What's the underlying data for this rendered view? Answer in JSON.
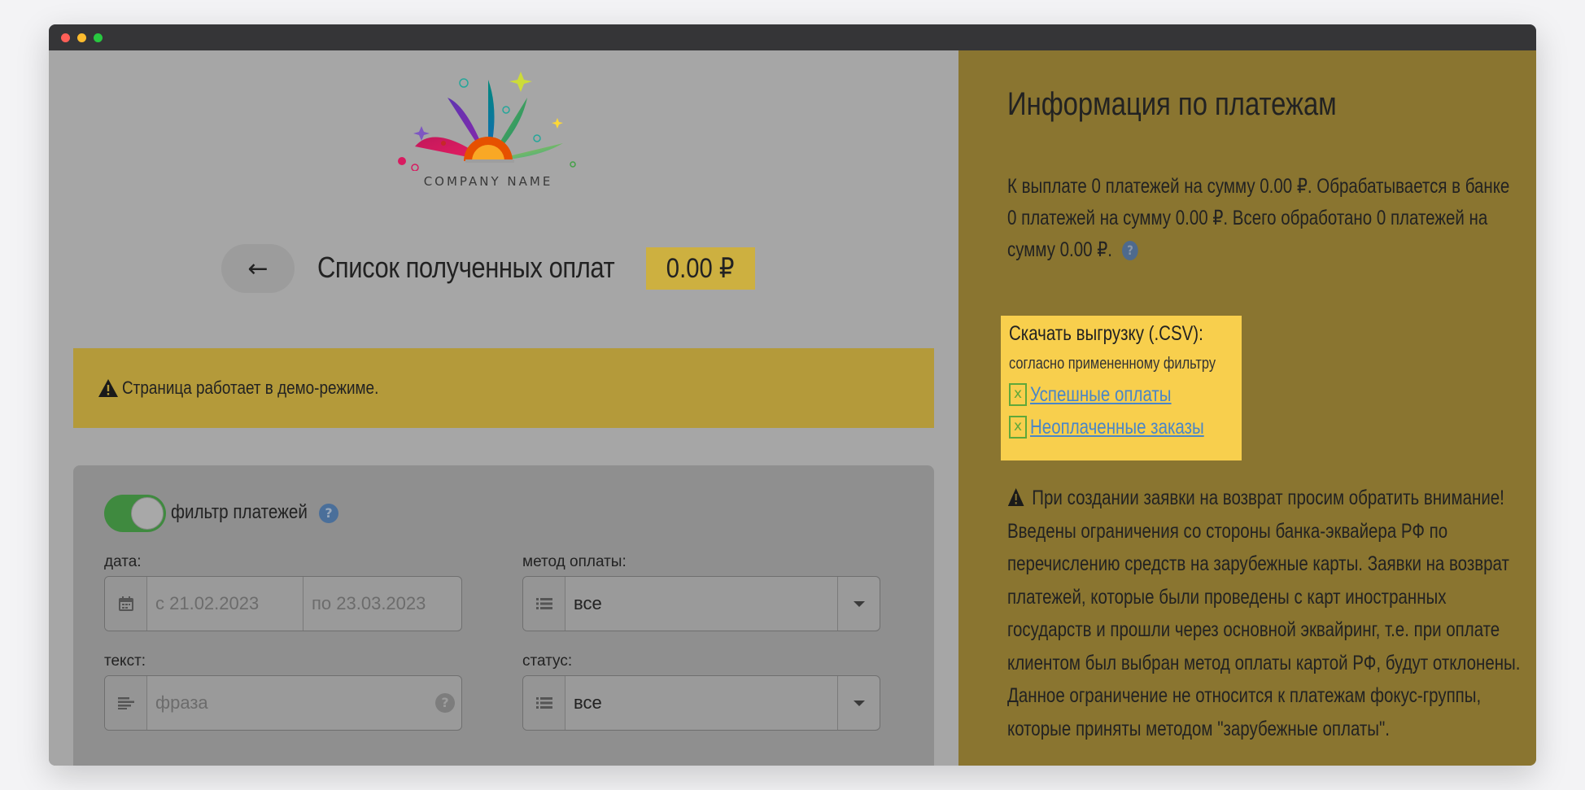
{
  "window": {
    "controls": [
      "close",
      "minimize",
      "maximize"
    ]
  },
  "logo": {
    "company_name": "COMPANY NAME"
  },
  "header": {
    "back_label": "←",
    "title": "Список полученных оплат",
    "total": "0.00 ₽"
  },
  "demo_alert": {
    "icon": "warning-icon",
    "text": "Страница работает в демо-режиме."
  },
  "filter": {
    "toggle_label": "фильтр платежей",
    "toggle_on": true,
    "date": {
      "label": "дата:",
      "from_placeholder": "с 21.02.2023",
      "to_placeholder": "по 23.03.2023"
    },
    "payment_method": {
      "label": "метод оплаты:",
      "value": "все"
    },
    "text": {
      "label": "текст:",
      "placeholder": "фраза"
    },
    "status": {
      "label": "статус:",
      "value": "все"
    }
  },
  "info": {
    "title": "Информация по платежам",
    "summary": "К выплате 0 платежей на сумму 0.00 ₽. Обрабатывается в банке 0 платежей на сумму 0.00 ₽. Всего обработано 0 платежей на сумму 0.00 ₽.",
    "csv": {
      "title": "Скачать выгрузку (.CSV):",
      "subtitle": "согласно примененному фильтру",
      "links": [
        "Успешные оплаты",
        "Неоплаченные заказы"
      ]
    },
    "notice": "При создании заявки на возврат просим обратить внимание! Введены ограничения со стороны банка-эквайера РФ по перечислению средств на зарубежные карты. Заявки на возврат платежей, которые были проведены с карт иностранных государств и прошли через основной эквайринг, т.е. при оплате клиентом был выбран метод оплаты картой РФ, будут отклонены. Данное ограничение не относится к платежам фокус-группы, которые приняты методом \"зарубежные оплаты\"."
  },
  "colors": {
    "left_bg": "#a6a6a6",
    "right_bg": "#8a7530",
    "accent_yellow": "#f8cf4d",
    "link_blue": "#4a86c7",
    "toggle_green": "#3f8a3f"
  }
}
